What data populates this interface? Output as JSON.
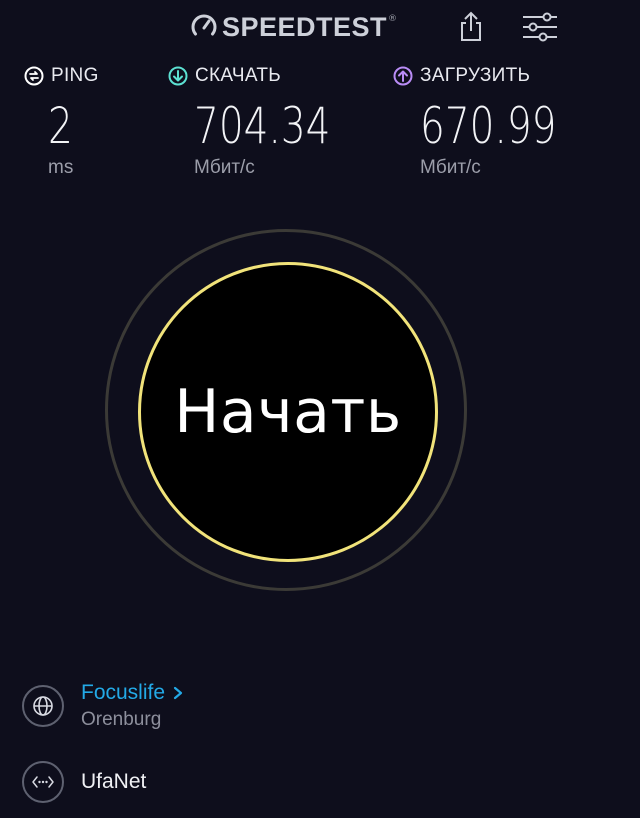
{
  "header": {
    "logo_text": "SPEEDTEST",
    "logo_mark": "®",
    "logo_icon": "speedometer-icon",
    "share_icon": "share-icon",
    "settings_icon": "sliders-icon"
  },
  "metrics": {
    "ping": {
      "label": "PING",
      "value": "2",
      "unit": "ms",
      "icon": "ping-icon",
      "color": "#ffffff"
    },
    "download": {
      "label": "СКАЧАТЬ",
      "value": "704.34",
      "unit": "Мбит/с",
      "icon": "download-arrow-icon",
      "color": "#5ce0d2"
    },
    "upload": {
      "label": "ЗАГРУЗИТЬ",
      "value": "670.99",
      "unit": "Мбит/с",
      "icon": "upload-arrow-icon",
      "color": "#b98cf6"
    }
  },
  "start_button": {
    "label": "Начать",
    "ring_color": "#f1e37a"
  },
  "provider": {
    "name": "Focuslife",
    "location": "Orenburg",
    "icon": "globe-icon",
    "chevron": "chevron-right-icon"
  },
  "server": {
    "name": "UfaNet",
    "icon": "server-dots-icon"
  },
  "colors": {
    "background": "#0e0e1c",
    "accent_blue": "#23a9e6"
  }
}
